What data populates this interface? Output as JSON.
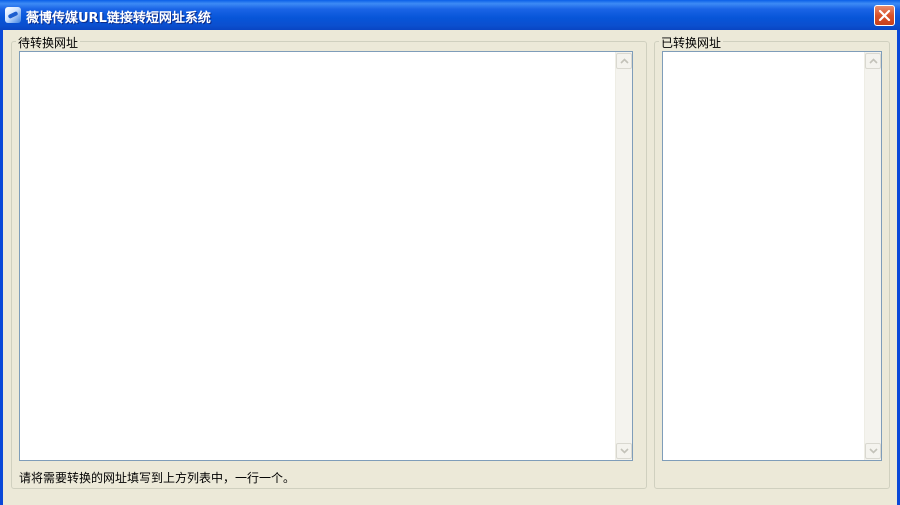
{
  "window": {
    "title": "薇博传媒URL链接转短网址系统",
    "icon": "app-icon",
    "close_icon": "close-icon"
  },
  "source_group": {
    "label": "待转换网址",
    "textarea_value": "",
    "hint": "请将需要转换的网址填写到上方列表中，一行一个。"
  },
  "result_group": {
    "label": "已转换网址",
    "textarea_value": ""
  },
  "colors": {
    "titlebar": "#0a5fe8",
    "close_button": "#d9522a",
    "client_bg": "#ece9d8",
    "textbox_border": "#7f9db9"
  }
}
